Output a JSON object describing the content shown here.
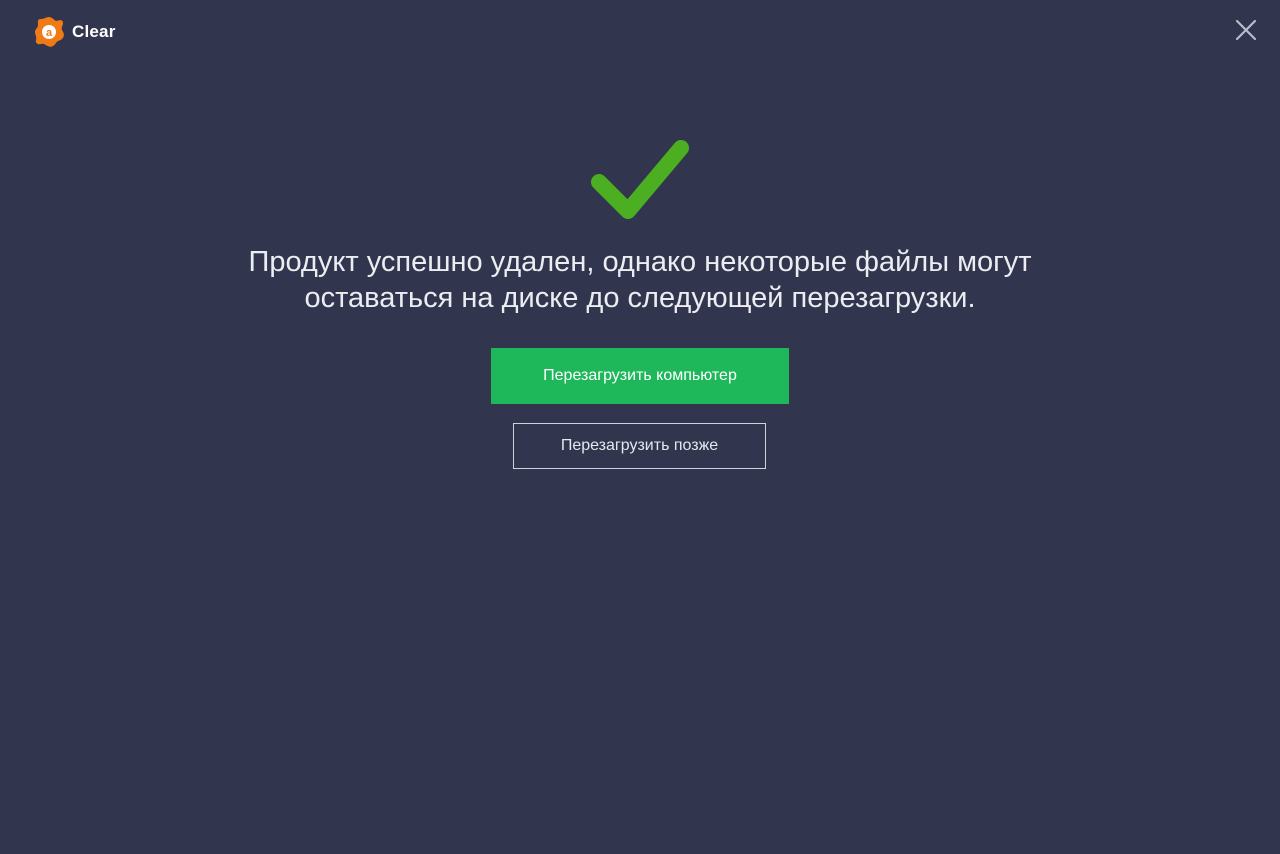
{
  "header": {
    "app_name": "Clear",
    "logo_icon": "avast-logo-icon",
    "close_icon": "close-icon"
  },
  "main": {
    "status_icon": "checkmark-icon",
    "message_line1": "Продукт успешно удален, однако некоторые файлы могут",
    "message_line2": "оставаться на диске до следующей перезагрузки.",
    "restart_now_label": "Перезагрузить компьютер",
    "restart_later_label": "Перезагрузить позже"
  },
  "colors": {
    "background": "#31354d",
    "primary_button": "#1eb85b",
    "checkmark": "#4caf22",
    "logo": "#f07a15"
  }
}
